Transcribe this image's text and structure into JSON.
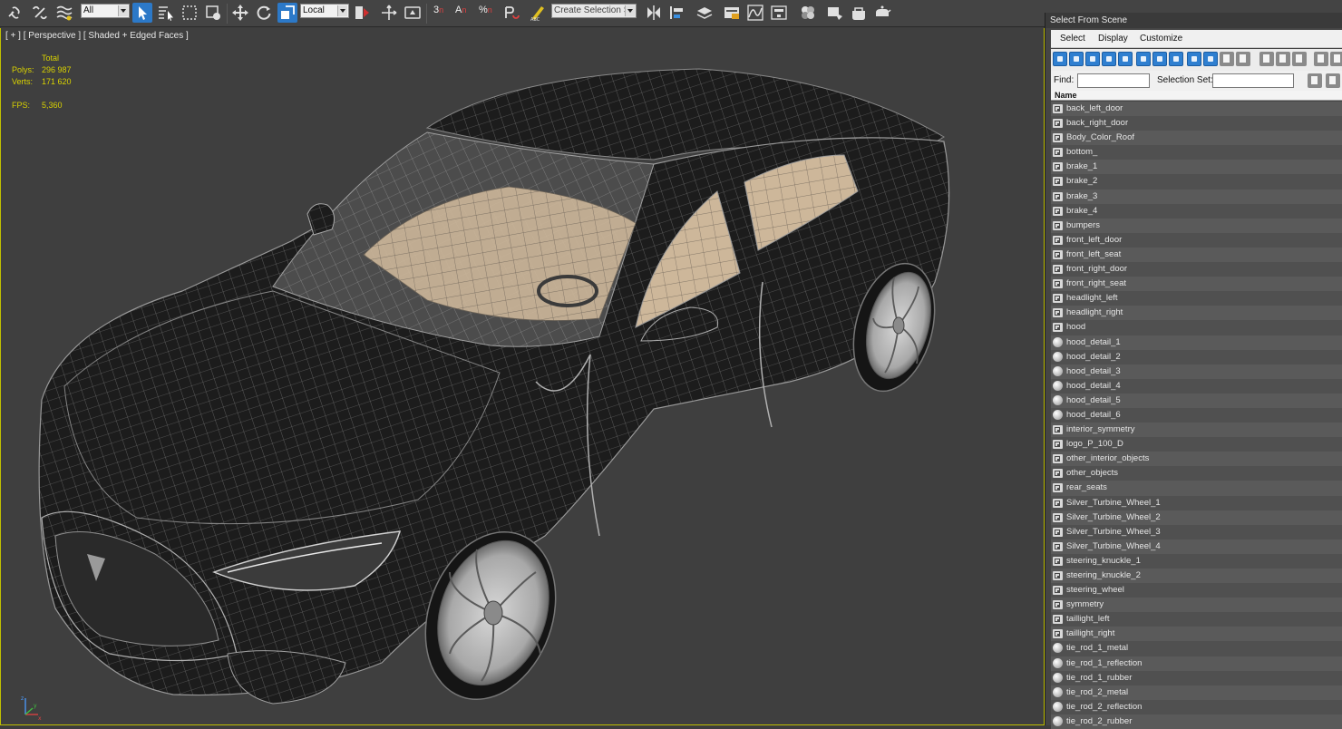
{
  "toolbar": {
    "filter_dropdown": "All",
    "coordinate_system": "Local",
    "snap_label": "3",
    "angle_snap_label": "A",
    "percent_snap_label": "%",
    "selection_set_placeholder": "Create Selection Se"
  },
  "viewport": {
    "label": "[ + ] [ Perspective ] [ Shaded + Edged Faces ]",
    "stats": {
      "total_label": "Total",
      "polys_label": "Polys:",
      "polys_value": "296 987",
      "verts_label": "Verts:",
      "verts_value": "171 620",
      "fps_label": "FPS:",
      "fps_value": "5,360"
    },
    "gizmo_axes": {
      "x": "x",
      "y": "y",
      "z": "z"
    },
    "colors": {
      "viewport_border": "#c0c000",
      "stats_text": "#d9d200",
      "mesh_body": "#1c1c1c",
      "wire": "#8c8c8c",
      "interior": "#cdb79a"
    }
  },
  "panel": {
    "title": "Select From Scene",
    "menu": [
      "Select",
      "Display",
      "Customize"
    ],
    "find_label": "Find:",
    "selection_set_label": "Selection Set:",
    "column_header": "Name",
    "items": [
      {
        "name": "back_left_door",
        "icon": "mesh-icon"
      },
      {
        "name": "back_right_door",
        "icon": "mesh-icon"
      },
      {
        "name": "Body_Color_Roof",
        "icon": "mesh-icon"
      },
      {
        "name": "bottom_",
        "icon": "mesh-icon"
      },
      {
        "name": "brake_1",
        "icon": "mesh-icon"
      },
      {
        "name": "brake_2",
        "icon": "mesh-icon"
      },
      {
        "name": "brake_3",
        "icon": "mesh-icon"
      },
      {
        "name": "brake_4",
        "icon": "mesh-icon"
      },
      {
        "name": "bumpers",
        "icon": "mesh-icon"
      },
      {
        "name": "front_left_door",
        "icon": "mesh-icon"
      },
      {
        "name": "front_left_seat",
        "icon": "mesh-icon"
      },
      {
        "name": "front_right_door",
        "icon": "mesh-icon"
      },
      {
        "name": "front_right_seat",
        "icon": "mesh-icon"
      },
      {
        "name": "headlight_left",
        "icon": "mesh-icon"
      },
      {
        "name": "headlight_right",
        "icon": "mesh-icon"
      },
      {
        "name": "hood",
        "icon": "mesh-icon"
      },
      {
        "name": "hood_detail_1",
        "icon": "sphere-icon"
      },
      {
        "name": "hood_detail_2",
        "icon": "sphere-icon"
      },
      {
        "name": "hood_detail_3",
        "icon": "sphere-icon"
      },
      {
        "name": "hood_detail_4",
        "icon": "sphere-icon"
      },
      {
        "name": "hood_detail_5",
        "icon": "sphere-icon"
      },
      {
        "name": "hood_detail_6",
        "icon": "sphere-icon"
      },
      {
        "name": "interior_symmetry",
        "icon": "mesh-icon"
      },
      {
        "name": "logo_P_100_D",
        "icon": "mesh-icon"
      },
      {
        "name": "other_interior_objects",
        "icon": "mesh-icon"
      },
      {
        "name": "other_objects",
        "icon": "mesh-icon"
      },
      {
        "name": "rear_seats",
        "icon": "mesh-icon"
      },
      {
        "name": "Silver_Turbine_Wheel_1",
        "icon": "mesh-icon"
      },
      {
        "name": "Silver_Turbine_Wheel_2",
        "icon": "mesh-icon"
      },
      {
        "name": "Silver_Turbine_Wheel_3",
        "icon": "mesh-icon"
      },
      {
        "name": "Silver_Turbine_Wheel_4",
        "icon": "mesh-icon"
      },
      {
        "name": "steering_knuckle_1",
        "icon": "mesh-icon"
      },
      {
        "name": "steering_knuckle_2",
        "icon": "mesh-icon"
      },
      {
        "name": "steering_wheel",
        "icon": "mesh-icon"
      },
      {
        "name": "symmetry",
        "icon": "mesh-icon"
      },
      {
        "name": "taillight_left",
        "icon": "mesh-icon"
      },
      {
        "name": "taillight_right",
        "icon": "mesh-icon"
      },
      {
        "name": "tie_rod_1_metal",
        "icon": "sphere-icon"
      },
      {
        "name": "tie_rod_1_reflection",
        "icon": "sphere-icon"
      },
      {
        "name": "tie_rod_1_rubber",
        "icon": "sphere-icon"
      },
      {
        "name": "tie_rod_2_metal",
        "icon": "sphere-icon"
      },
      {
        "name": "tie_rod_2_reflection",
        "icon": "sphere-icon"
      },
      {
        "name": "tie_rod_2_rubber",
        "icon": "sphere-icon"
      }
    ]
  }
}
